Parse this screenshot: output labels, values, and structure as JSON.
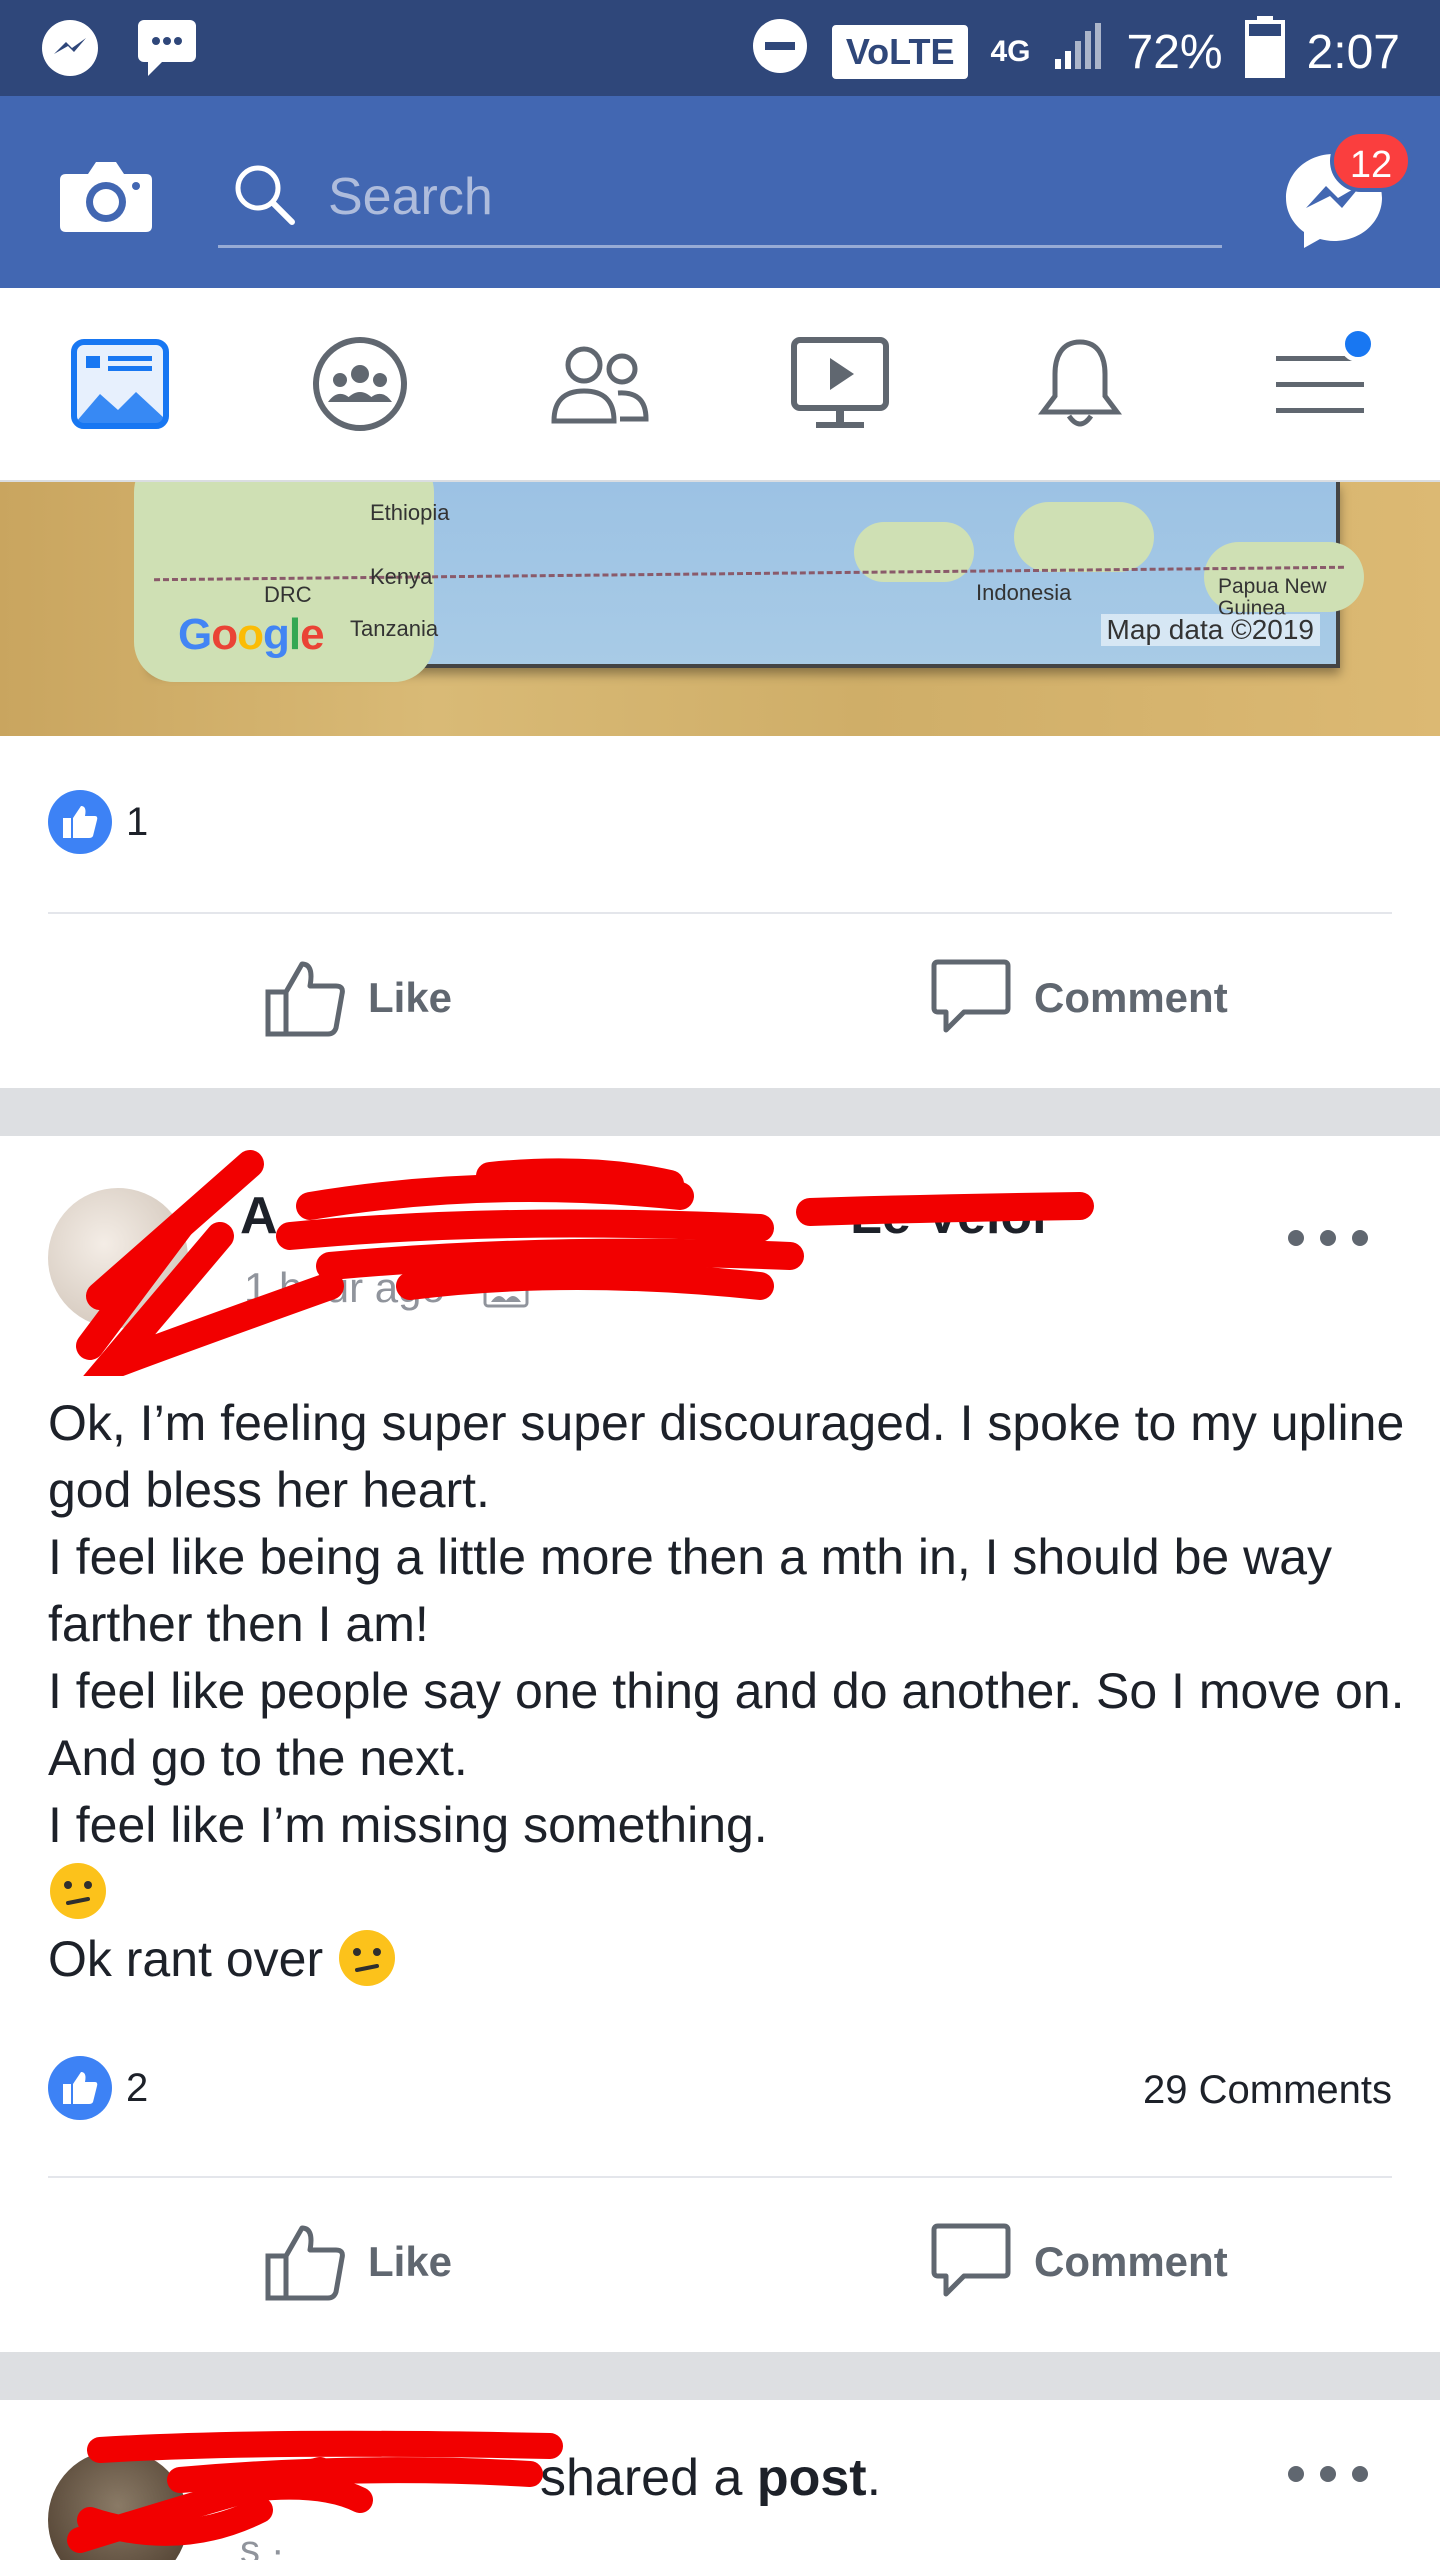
{
  "status_bar": {
    "battery": "72%",
    "time": "2:07",
    "network": "VoLTE",
    "signal_type": "4G"
  },
  "top_bar": {
    "search_placeholder": "Search",
    "messenger_badge": "12"
  },
  "nav_tabs": [
    "news-feed",
    "groups",
    "friends",
    "watch",
    "notifications",
    "menu"
  ],
  "post1": {
    "map_labels": {
      "ethiopia": "Ethiopia",
      "kenya": "Kenya",
      "drc": "DRC",
      "tanzania": "Tanzania",
      "indonesia": "Indonesia",
      "papua": "Papua New Guinea",
      "google": "Google",
      "map_data": "Map data ©2019"
    },
    "like_count": "1",
    "actions": {
      "like": "Like",
      "comment": "Comment"
    }
  },
  "post2": {
    "author_visible": "A",
    "author_suffix": "Le Velor",
    "time": "1 hour ago",
    "body_lines": [
      "Ok, I’m feeling super super discouraged. I spoke to my upline god bless her heart.",
      "I feel like being a little more then a mth in, I should be way farther then I am!",
      "I feel like people say one thing and do another. So I move on. And go to the next.",
      "I feel like I’m missing something.",
      "Ok rant over"
    ],
    "like_count": "2",
    "comments": "29 Comments",
    "actions": {
      "like": "Like",
      "comment": "Comment"
    }
  },
  "post3": {
    "shared_text": "shared a",
    "shared_bold": "post",
    "shared_period": ".",
    "meta": "s ·"
  },
  "colors": {
    "status_bar": "#2f477a",
    "brand_blue": "#4267b2",
    "like_blue": "#3d82f5",
    "badge_red": "#fa3e3e",
    "scribble_red": "#f20000"
  }
}
